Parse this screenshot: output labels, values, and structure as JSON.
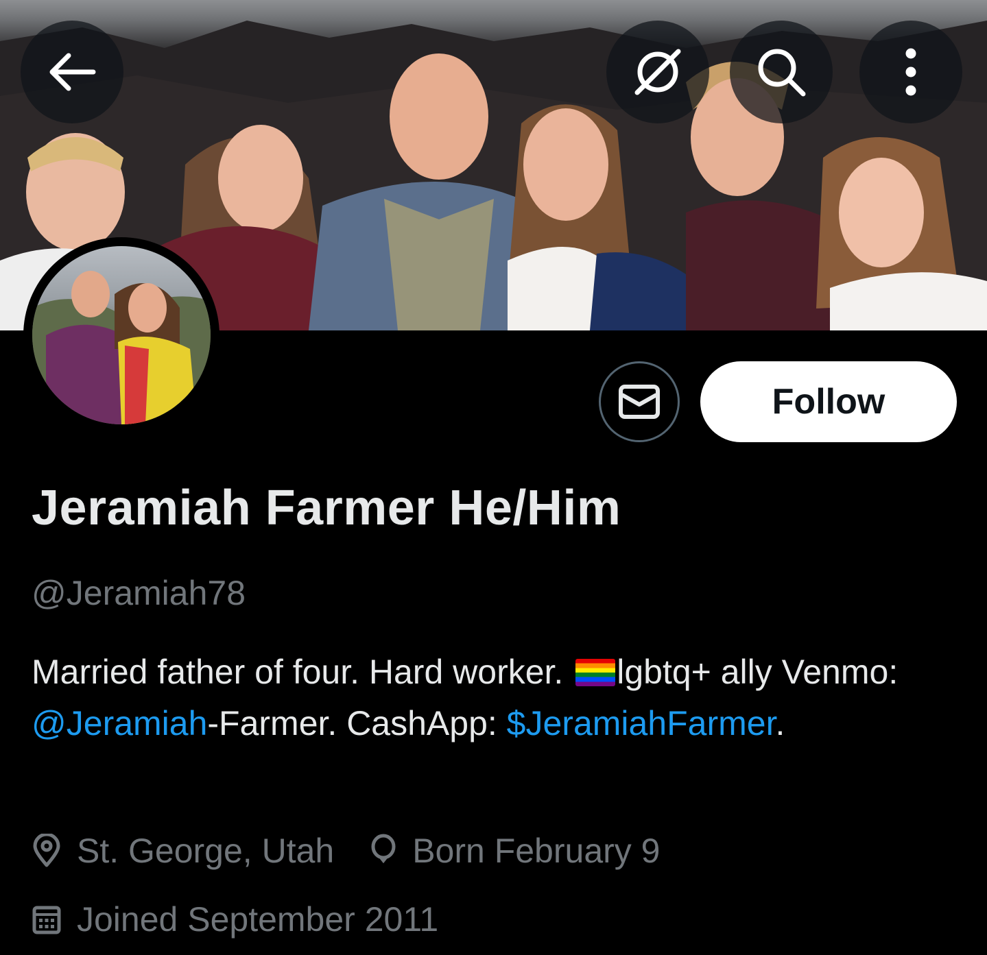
{
  "header": {
    "back_icon": "arrow-left-icon",
    "translate_icon": "no-translate-icon",
    "search_icon": "search-icon",
    "more_icon": "more-vertical-icon"
  },
  "actions": {
    "message_icon": "envelope-icon",
    "follow_label": "Follow"
  },
  "profile": {
    "display_name": "Jeramiah Farmer He/Him",
    "handle": "@Jeramiah78",
    "bio": {
      "part1": "Married father of four. Hard worker. ",
      "flag_icon": "rainbow-flag-icon",
      "part2": "lgbtq+ ally Venmo: ",
      "venmo_link": "@Jeramiah",
      "part3": "-Farmer. CashApp: ",
      "cashapp_link": "$JeramiahFarmer",
      "part4": "."
    },
    "location": "St. George, Utah",
    "birthday": "Born February 9",
    "joined": "Joined September 2011"
  },
  "colors": {
    "background": "#000000",
    "text_primary": "#e7e9ea",
    "text_secondary": "#71767b",
    "link": "#1d9bf0",
    "follow_bg": "#ffffff",
    "follow_text": "#0f1419"
  }
}
